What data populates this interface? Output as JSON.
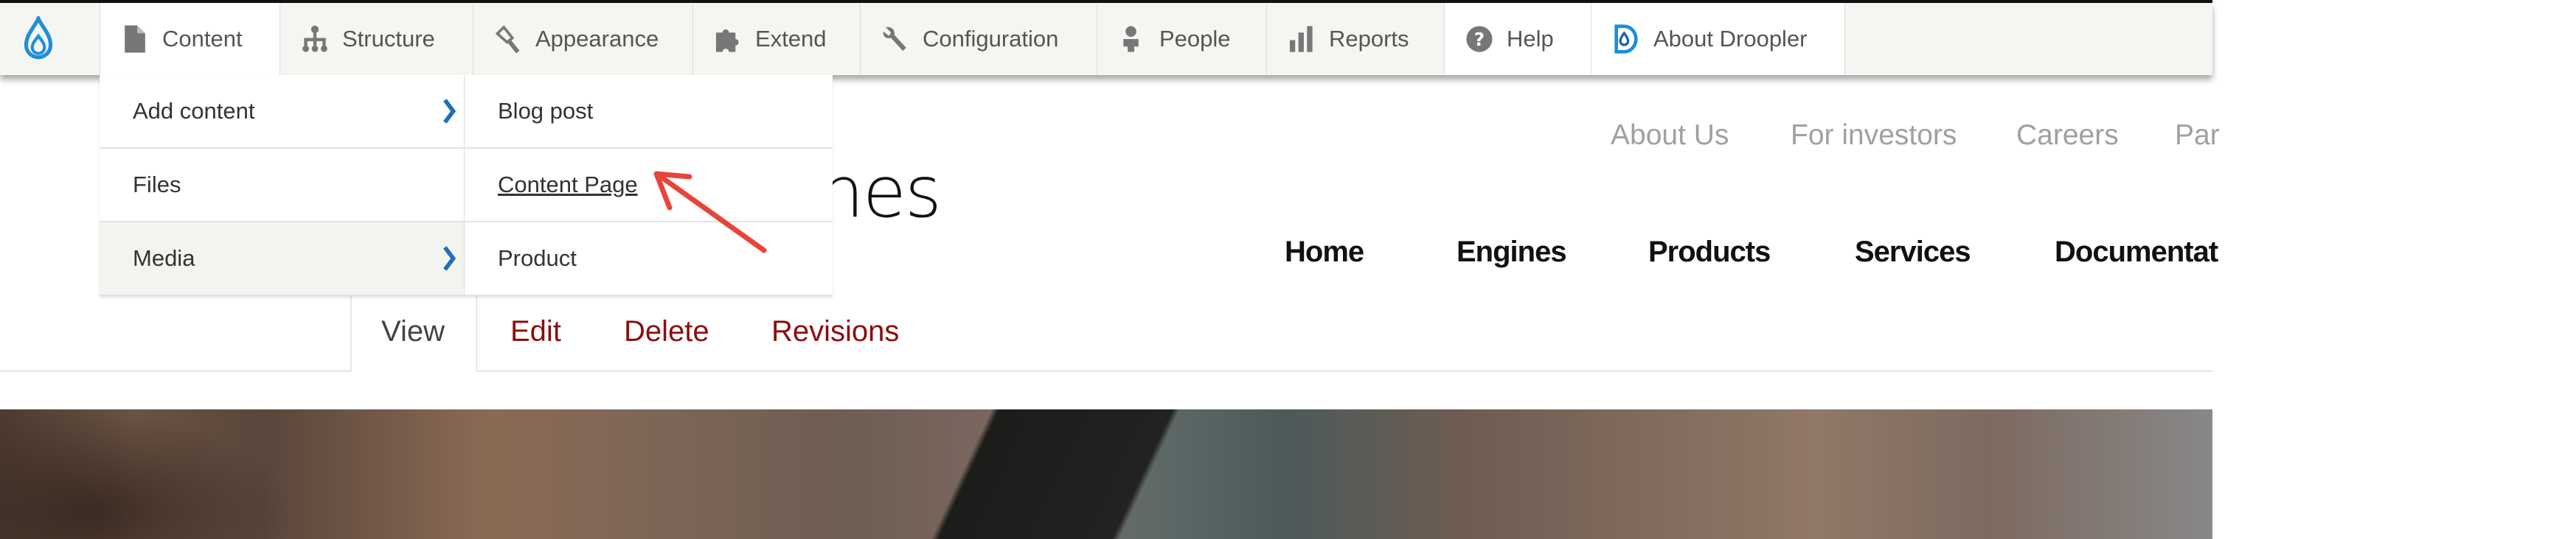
{
  "toolbar": {
    "items": [
      {
        "label": "Content",
        "icon": "file-icon"
      },
      {
        "label": "Structure",
        "icon": "sitemap-icon"
      },
      {
        "label": "Appearance",
        "icon": "paintbrush-icon"
      },
      {
        "label": "Extend",
        "icon": "puzzle-icon"
      },
      {
        "label": "Configuration",
        "icon": "wrench-icon"
      },
      {
        "label": "People",
        "icon": "person-icon"
      },
      {
        "label": "Reports",
        "icon": "bar-chart-icon"
      },
      {
        "label": "Help",
        "icon": "help-icon"
      },
      {
        "label": "About Droopler",
        "icon": "droopler-logo-icon"
      }
    ],
    "accent": "#1e8fd8"
  },
  "dropdown": {
    "level1": [
      {
        "label": "Add content",
        "has_children": true
      },
      {
        "label": "Files",
        "has_children": false
      },
      {
        "label": "Media",
        "has_children": true
      }
    ],
    "level2": [
      {
        "label": "Blog post"
      },
      {
        "label": "Content Page"
      },
      {
        "label": "Product"
      }
    ]
  },
  "page": {
    "title_visible": "nes"
  },
  "secondary_menu": [
    "About Us",
    "For investors",
    "Careers",
    "Par"
  ],
  "main_menu": [
    "Home",
    "Engines",
    "Products",
    "Services",
    "Documentat"
  ],
  "tabs": [
    "View",
    "Edit",
    "Delete",
    "Revisions"
  ],
  "colors": {
    "tab_link": "#8b0e0e",
    "annotation_arrow": "#e8443a"
  }
}
